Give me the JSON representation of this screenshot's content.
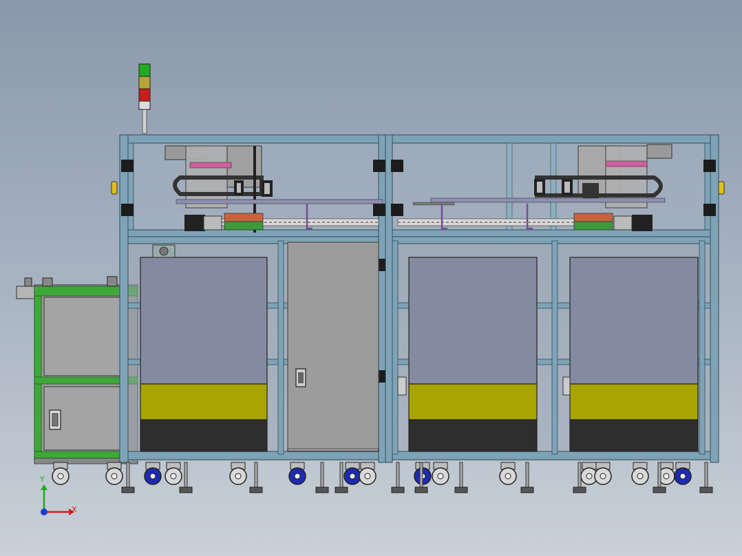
{
  "scene": {
    "title": "",
    "colors": {
      "background_top": "#8a98ab",
      "background_bottom": "#c9d0d8",
      "frame": "#7fa3b6",
      "frame_dark": "#4a6f80",
      "side_frame": "#3fa83a",
      "panel_blue": "#848aa0",
      "panel_grey": "#a8a8a8",
      "door": "#9c9c9c",
      "yellow_band": "#a8a400",
      "dark_band": "#2e2e2e",
      "tower_green": "#22aa22",
      "tower_amber": "#b8a53a",
      "tower_red": "#c81e1e",
      "caster_blue": "#1c2bb0",
      "module_orange": "#c8643c",
      "module_green": "#3c9a3c"
    },
    "axis_triad": {
      "x_label": "X",
      "y_label": "Y",
      "x_color": "#d01e1e",
      "y_color": "#1eaa1e",
      "z_color": "#1e3cd0"
    }
  }
}
